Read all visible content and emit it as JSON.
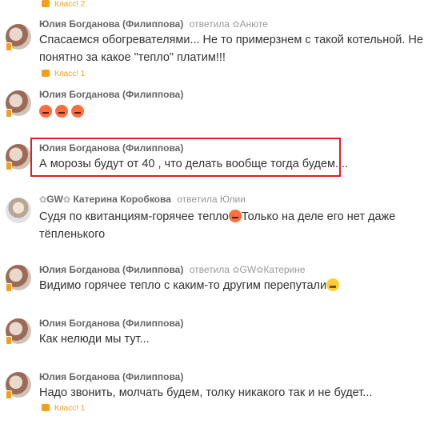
{
  "comments": [
    {
      "klass": "Класс! 2"
    },
    {
      "author": "Юлия Богданова (Филиппова)",
      "replied": "ответила",
      "reply_to": "Анюте",
      "text_line1": "Спасаемся обогревателями... Не то примерзнем с такой котельной. Не",
      "text_line2": "понятно за какое \"тепло\" платим!!!",
      "klass": "Класс! 1"
    },
    {
      "author": "Юлия Богданова (Филиппова)",
      "emoji_count": 3
    },
    {
      "author": "Юлия Богданова (Филиппова)",
      "text_line1": "А морозы будут от 40 , что делать вообще тогда будем....",
      "highlighted": true
    },
    {
      "author_prefix": "GW",
      "author": "Катерина Коробкова",
      "replied": "ответила Юлии",
      "text_line1": "Судя по квитанциям-горячее тепло",
      "text_line1_b": "Только на деле его нет даже",
      "text_line2": "тёпленького"
    },
    {
      "author": "Юлия Богданова (Филиппова)",
      "replied": "ответила",
      "reply_to_prefix": "GW",
      "reply_to": "Катерине",
      "text_line1": "Видимо горячее тепло с каким-то другим перепутали"
    },
    {
      "author": "Юлия Богданова (Филиппова)",
      "text_line1": "Как нелюди мы тут..."
    },
    {
      "author": "Юлия Богданова (Филиппова)",
      "text_line1": "Надо звонить, молчать будем, толку никакого так и не будет...",
      "klass": "Класс! 1"
    }
  ],
  "colors": {
    "accent": "#f59f19",
    "highlight_border": "#e31b23",
    "author": "#666666",
    "muted": "#999999",
    "text": "#333333"
  }
}
